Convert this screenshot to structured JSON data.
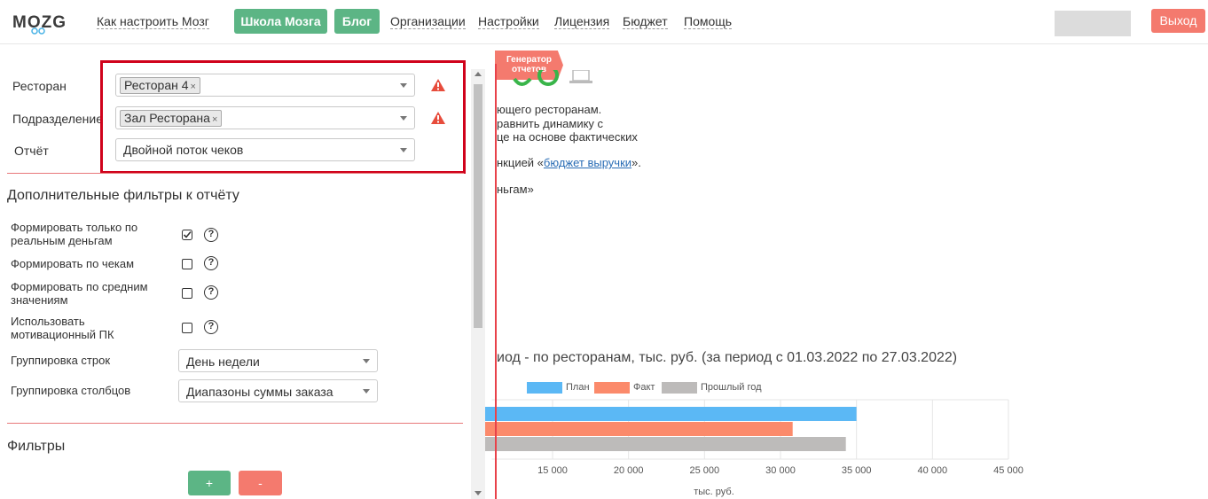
{
  "header": {
    "logo_text": "MOZG",
    "nav": [
      "Как настроить Мозг",
      "Школа Мозга",
      "Блог",
      "Организации",
      "Настройки",
      "Лицензия",
      "Бюджет",
      "Помощь"
    ],
    "exit_label": "Выход"
  },
  "form": {
    "restaurant_label": "Ресторан",
    "restaurant_tag": "Ресторан 4",
    "department_label": "Подразделение",
    "department_tag": "Зал Ресторана",
    "report_label": "Отчёт",
    "report_value": "Двойной поток чеков",
    "remove_symbol": "×"
  },
  "extra_filters": {
    "title": "Дополнительные фильтры к отчёту",
    "options": [
      {
        "label": "Формировать только по реальным деньгам",
        "checked": true
      },
      {
        "label": "Формировать по чекам",
        "checked": false
      },
      {
        "label": "Формировать по средним значениям",
        "checked": false
      },
      {
        "label": "Использовать мотивационный ПК",
        "checked": false
      }
    ],
    "help_symbol": "?",
    "row_grouping_label": "Группировка строк",
    "row_grouping_value": "День недели",
    "col_grouping_label": "Группировка столбцов",
    "col_grouping_value": "Диапазоны суммы заказа"
  },
  "filters": {
    "title": "Фильтры",
    "add_label": "+",
    "remove_label": "-"
  },
  "right": {
    "badge": "Генератор отчетов",
    "text_lines": [
      "ющего ресторанам.",
      "равнить динамику с",
      "це на основе фактических"
    ],
    "link_prefix": "нкцией «",
    "link_text": "бюджет выручки",
    "link_suffix": "».",
    "line_ngam": "ньгам»"
  },
  "chart_data": {
    "type": "bar",
    "title": "иод - по ресторанам, тыс. руб. (за период с 01.03.2022 по 27.03.2022)",
    "xlabel": "тыс. руб.",
    "ylabel": "",
    "orientation": "horizontal",
    "x_ticks": [
      "15 000",
      "20 000",
      "25 000",
      "30 000",
      "35 000",
      "40 000",
      "45 000"
    ],
    "xlim": [
      11000,
      45000
    ],
    "categories": [
      ""
    ],
    "series": [
      {
        "name": "План",
        "values": [
          35000
        ],
        "color": "#5bb8f5"
      },
      {
        "name": "Факт",
        "values": [
          30800
        ],
        "color": "#fb8a6b"
      },
      {
        "name": "Прошлый год",
        "values": [
          34300
        ],
        "color": "#bdbbba"
      }
    ],
    "grid": true,
    "legend": "top-left"
  }
}
